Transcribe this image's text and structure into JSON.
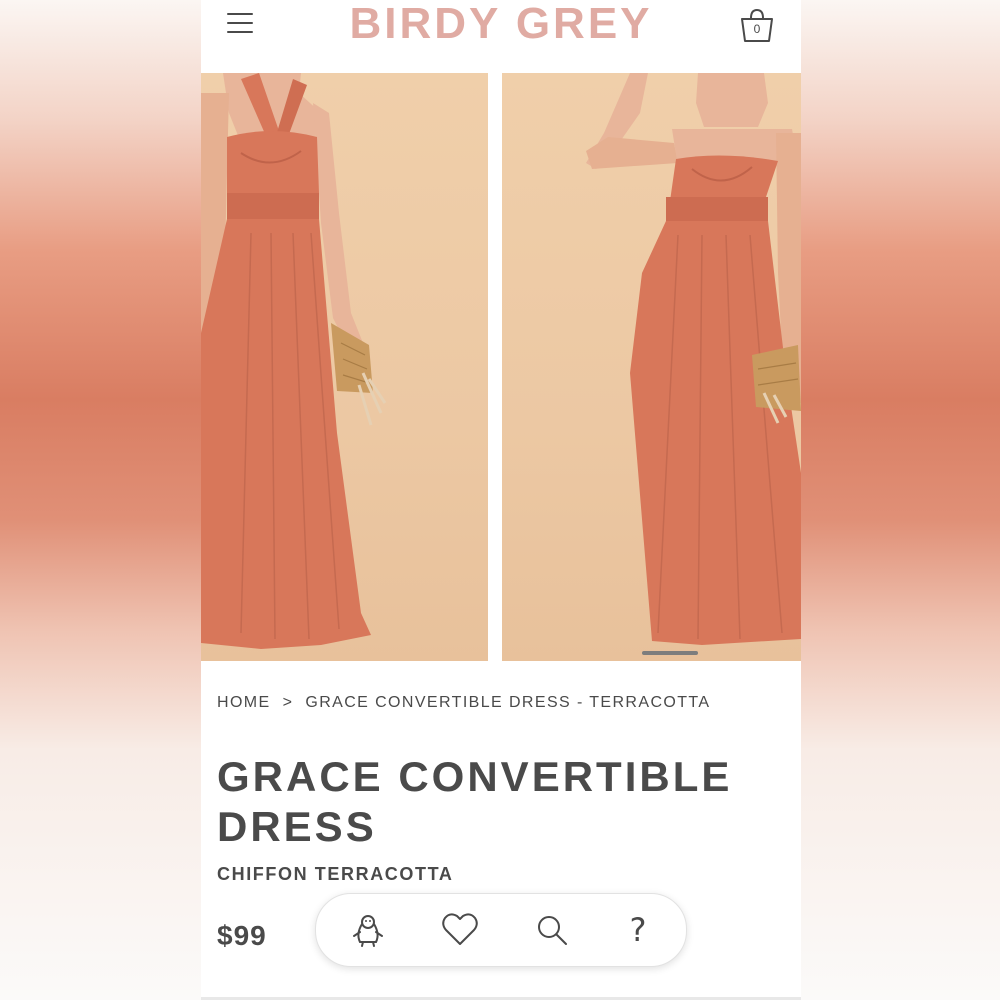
{
  "brand": {
    "logo_text": "BIRDY GREY",
    "logo_color": "#e0aba3"
  },
  "header": {
    "cart_count": "0"
  },
  "gallery": {
    "images": [
      {
        "description": "model-halter-style-terracotta-dress"
      },
      {
        "description": "model-strapless-style-terracotta-dress"
      }
    ],
    "dress_color": "#d8775a"
  },
  "breadcrumb": {
    "home": "HOME",
    "separator": ">",
    "current": "GRACE CONVERTIBLE DRESS - TERRACOTTA"
  },
  "product": {
    "title": "GRACE CONVERTIBLE DRESS",
    "fabric_color": "CHIFFON TERRACOTTA",
    "price": "$99"
  },
  "toolbar": {
    "icons": [
      "penguin-icon",
      "heart-icon",
      "search-icon",
      "help-icon"
    ],
    "help_glyph": "?"
  },
  "colors": {
    "text": "#4a4a4a",
    "accent": "#e0aba3",
    "background": "#ffffff"
  }
}
